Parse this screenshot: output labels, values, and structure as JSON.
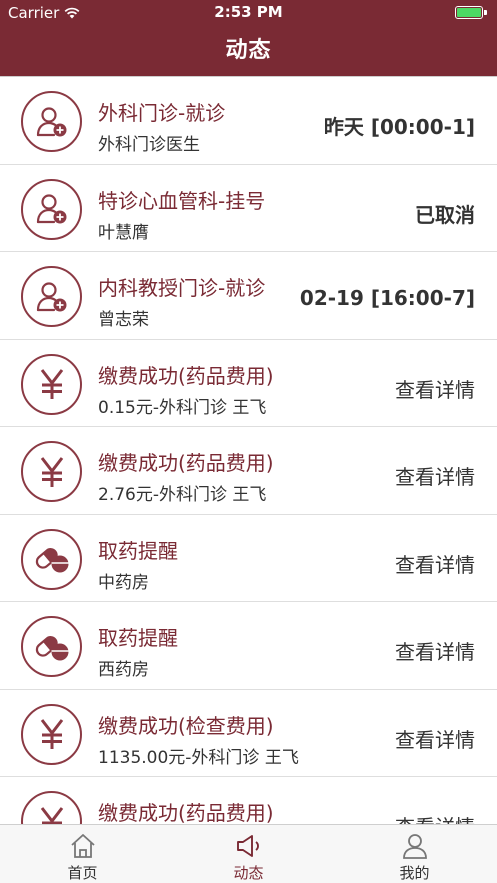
{
  "status_bar": {
    "carrier": "Carrier",
    "time": "2:53 PM",
    "battery_level": 1.0
  },
  "nav": {
    "title": "动态"
  },
  "colors": {
    "brand": "#7a2a34",
    "icon_stroke": "#8b3a44",
    "battery": "#4cd964"
  },
  "list": [
    {
      "icon": "doctor-add-icon",
      "title": "外科门诊-就诊",
      "subtitle": "外科门诊医生",
      "right": "昨天 [00:00-1]",
      "right_type": "time"
    },
    {
      "icon": "doctor-add-icon",
      "title": "特诊心血管科-挂号",
      "subtitle": "叶慧膺",
      "right": "已取消",
      "right_type": "status"
    },
    {
      "icon": "doctor-add-icon",
      "title": "内科教授门诊-就诊",
      "subtitle": "曾志荣",
      "right": "02-19 [16:00-7]",
      "right_type": "time"
    },
    {
      "icon": "yuan-icon",
      "title": "缴费成功(药品费用)",
      "subtitle": "0.15元-外科门诊 王飞",
      "right": "查看详情",
      "right_type": "action"
    },
    {
      "icon": "yuan-icon",
      "title": "缴费成功(药品费用)",
      "subtitle": "2.76元-外科门诊 王飞",
      "right": "查看详情",
      "right_type": "action"
    },
    {
      "icon": "pill-icon",
      "title": "取药提醒",
      "subtitle": "中药房",
      "right": "查看详情",
      "right_type": "action"
    },
    {
      "icon": "pill-icon",
      "title": "取药提醒",
      "subtitle": "西药房",
      "right": "查看详情",
      "right_type": "action"
    },
    {
      "icon": "yuan-icon",
      "title": "缴费成功(检查费用)",
      "subtitle": "1135.00元-外科门诊 王飞",
      "right": "查看详情",
      "right_type": "action"
    },
    {
      "icon": "yuan-icon",
      "title": "缴费成功(药品费用)",
      "subtitle": "",
      "right": "查看详情",
      "right_type": "action"
    }
  ],
  "tabs": [
    {
      "label": "首页",
      "icon": "home-icon",
      "active": false
    },
    {
      "label": "动态",
      "icon": "megaphone-icon",
      "active": true
    },
    {
      "label": "我的",
      "icon": "person-icon",
      "active": false
    }
  ]
}
